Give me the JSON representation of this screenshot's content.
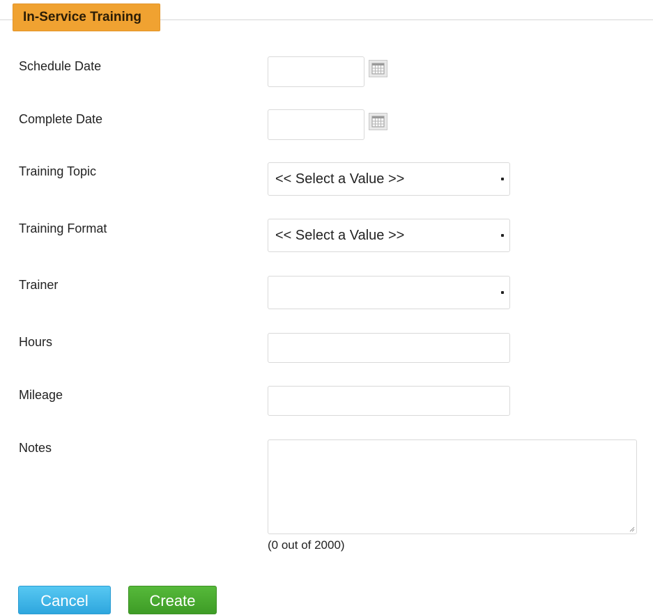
{
  "section": {
    "title": "In-Service Training",
    "accent_color": "#f0a231"
  },
  "form": {
    "schedule_date": {
      "label": "Schedule Date",
      "value": "",
      "icon": "calendar-icon"
    },
    "complete_date": {
      "label": "Complete Date",
      "value": "",
      "icon": "calendar-icon"
    },
    "training_topic": {
      "label": "Training Topic",
      "selected": "<< Select a Value >>"
    },
    "training_format": {
      "label": "Training Format",
      "selected": "<< Select a Value >>"
    },
    "trainer": {
      "label": "Trainer",
      "selected": ""
    },
    "hours": {
      "label": "Hours",
      "value": ""
    },
    "mileage": {
      "label": "Mileage",
      "value": ""
    },
    "notes": {
      "label": "Notes",
      "value": "",
      "counter": "(0 out of 2000)"
    }
  },
  "actions": {
    "cancel_label": "Cancel",
    "cancel_color": "#2ea6de",
    "create_label": "Create",
    "create_color": "#3e9c26"
  }
}
